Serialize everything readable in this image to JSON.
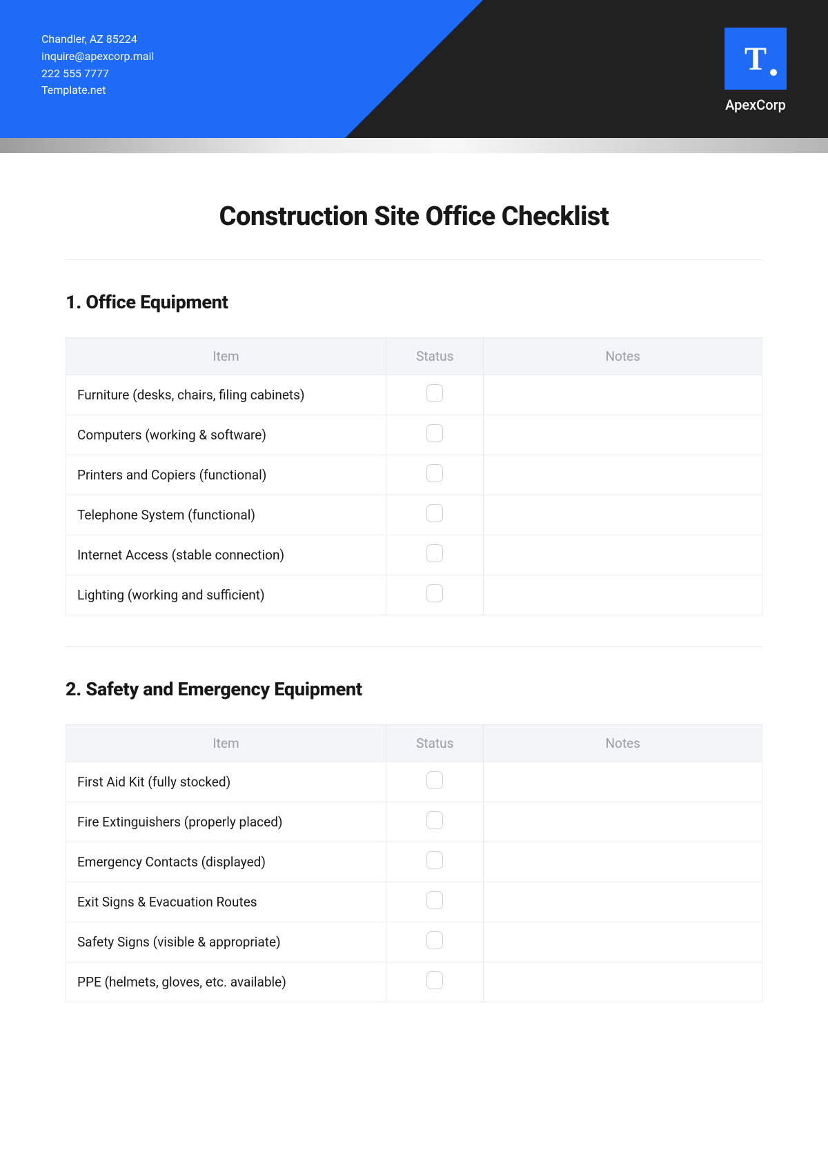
{
  "header": {
    "address": "Chandler, AZ 85224",
    "email": "inquire@apexcorp.mail",
    "phone": "222 555 7777",
    "website": "Template.net",
    "logo_letter": "T",
    "company_name": "ApexCorp"
  },
  "page_title": "Construction Site Office Checklist",
  "sections": [
    {
      "heading": "1. Office Equipment",
      "columns": {
        "item": "Item",
        "status": "Status",
        "notes": "Notes"
      },
      "rows": [
        {
          "item": "Furniture (desks, chairs, filing cabinets)",
          "notes": ""
        },
        {
          "item": "Computers (working & software)",
          "notes": ""
        },
        {
          "item": "Printers and Copiers (functional)",
          "notes": ""
        },
        {
          "item": "Telephone System (functional)",
          "notes": ""
        },
        {
          "item": "Internet Access (stable connection)",
          "notes": ""
        },
        {
          "item": "Lighting (working and sufficient)",
          "notes": ""
        }
      ]
    },
    {
      "heading": "2. Safety and Emergency Equipment",
      "columns": {
        "item": "Item",
        "status": "Status",
        "notes": "Notes"
      },
      "rows": [
        {
          "item": "First Aid Kit (fully stocked)",
          "notes": ""
        },
        {
          "item": "Fire Extinguishers (properly placed)",
          "notes": ""
        },
        {
          "item": "Emergency Contacts (displayed)",
          "notes": ""
        },
        {
          "item": "Exit Signs & Evacuation Routes",
          "notes": ""
        },
        {
          "item": "Safety Signs (visible & appropriate)",
          "notes": ""
        },
        {
          "item": "PPE (helmets, gloves, etc. available)",
          "notes": ""
        }
      ]
    }
  ]
}
